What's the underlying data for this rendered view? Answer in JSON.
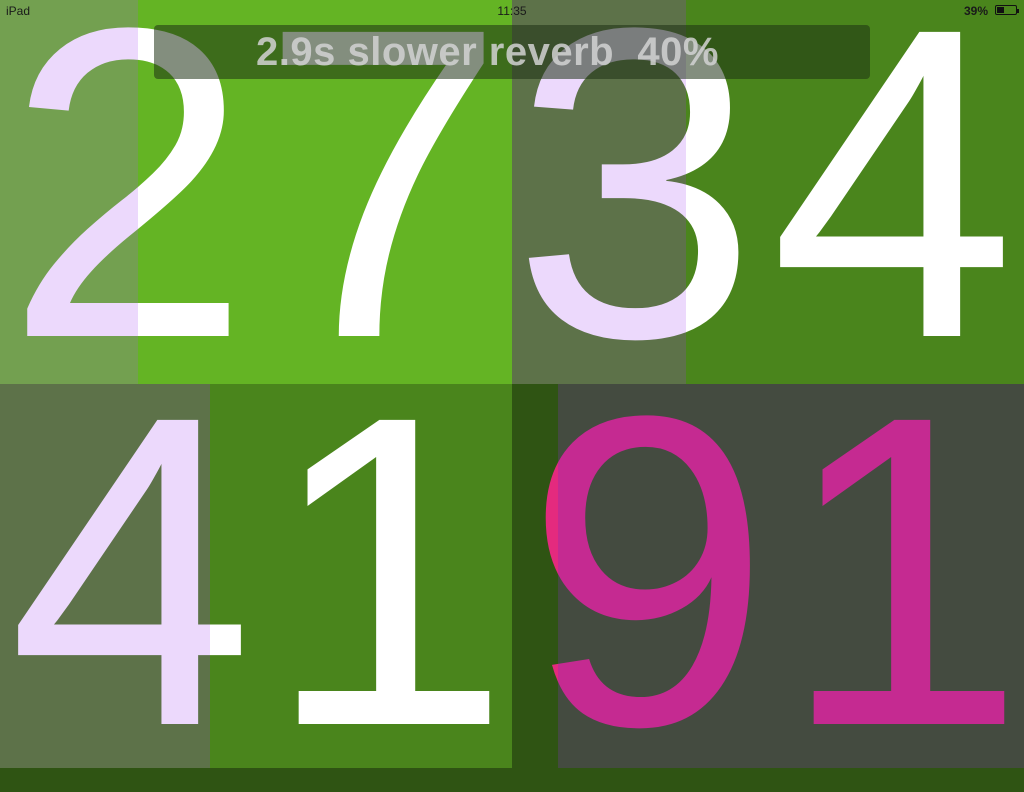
{
  "status_bar": {
    "device": "iPad",
    "time": "11:35",
    "battery_percent": "39%",
    "battery_level": 0.39
  },
  "overlay": {
    "text": "2.9s slower reverb  40%"
  },
  "top_row": {
    "digits": [
      "2",
      "7",
      "3",
      "4"
    ]
  },
  "bottom_row": {
    "digits": [
      "4",
      "1",
      "9",
      "1"
    ]
  },
  "colors": {
    "green_bright": "#64b424",
    "green_mid": "#4a851c",
    "green_muted": "#73a050",
    "grey_green": "#5d7249",
    "dark_grey": "#444b40",
    "digit_white": "#ffffff",
    "digit_lavender": "#ecd9fc",
    "digit_magenta": "#c52a91",
    "digit_pink": "#e42a7e"
  }
}
